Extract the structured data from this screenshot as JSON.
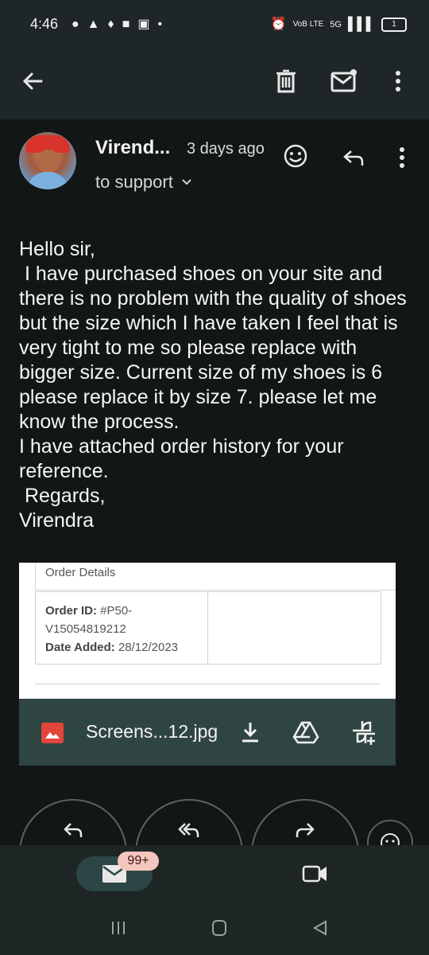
{
  "status_bar": {
    "time": "4:46",
    "battery": "1",
    "network": "5G",
    "volte": "VoB LTE"
  },
  "toolbar": {
    "back_icon": "arrow-left-icon",
    "delete_icon": "trash-icon",
    "mark_unread_icon": "mail-unread-icon",
    "more_icon": "more-vertical-icon"
  },
  "message": {
    "sender": "Virend...",
    "time_ago": "3 days ago",
    "to_line": "to support",
    "body": "Hello sir,\n I have purchased shoes on your site and there is no problem with the quality of shoes but the size which I have taken I feel that is very tight to me so please replace with bigger size. Current size of my shoes is 6 please replace it by size 7. please let me know the process.\nI have attached order history for your reference.\n Regards,\nVirendra"
  },
  "attachment": {
    "preview": {
      "section_title": "Order Details",
      "order_id_label": "Order ID:",
      "order_id_value": "#P50-V15054819212",
      "date_label": "Date Added:",
      "date_value": "28/12/2023"
    },
    "filename": "Screens...12.jpg",
    "icon_color": "#e2453b"
  },
  "actions": {
    "reply_icon": "reply-icon",
    "reply_all_icon": "reply-all-icon",
    "forward_icon": "forward-icon"
  },
  "bottom_nav": {
    "mail_badge": "99+",
    "video_icon": "video-camera-icon"
  },
  "colors": {
    "background": "#121616",
    "topbar": "#1f2627",
    "attach_bar": "#2f4542",
    "badge": "#f5c6bd"
  }
}
